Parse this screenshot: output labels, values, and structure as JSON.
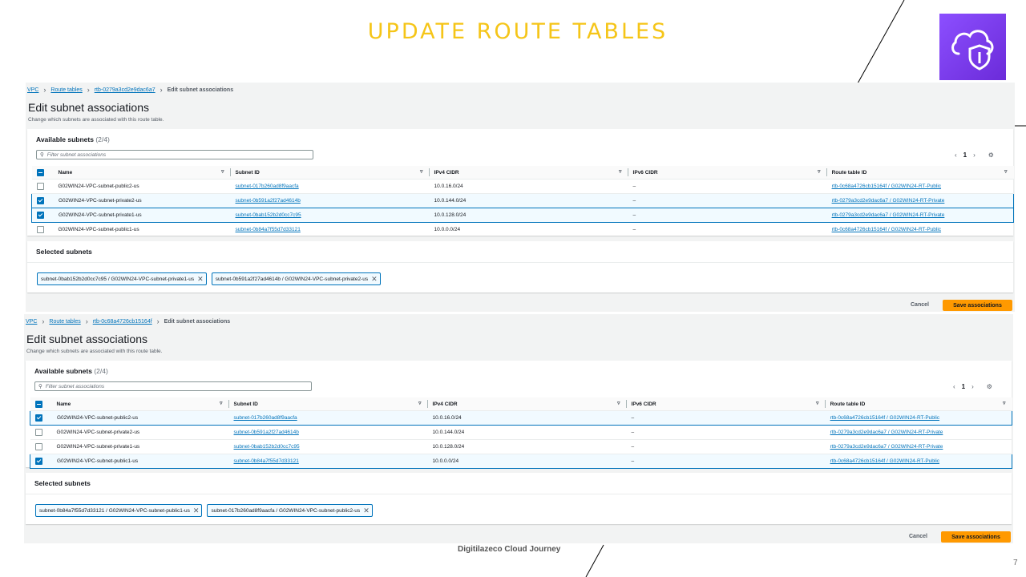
{
  "slide": {
    "title": "UPDATE ROUTE TABLES",
    "footer": "Digitilazeco Cloud Journey",
    "page_number": "7",
    "logo_icon": "cloud-shield-icon",
    "accent_color": "#f5c518",
    "aws_orange": "#ff9900",
    "link_color": "#0073bb"
  },
  "screens": [
    {
      "breadcrumbs": [
        "VPC",
        "Route tables",
        "rtb-0279a3cd2e9dac6a7",
        "Edit subnet associations"
      ],
      "title": "Edit subnet associations",
      "subtitle": "Change which subnets are associated with this route table.",
      "available_title": "Available subnets",
      "available_count": "(2/4)",
      "filter_placeholder": "Filter subnet associations",
      "page": "1",
      "columns": [
        "Name",
        "Subnet ID",
        "IPv4 CIDR",
        "IPv6 CIDR",
        "Route table ID"
      ],
      "rows": [
        {
          "checked": false,
          "name": "G02WIN24-VPC-subnet-public2-us",
          "subnet_id": "subnet-017b260ad8f9aacfa",
          "ipv4": "10.0.16.0/24",
          "ipv6": "–",
          "route_table": "rtb-0c68a4726cb15164f / G02WIN24-RT-Public"
        },
        {
          "checked": true,
          "name": "G02WIN24-VPC-subnet-private2-us",
          "subnet_id": "subnet-0b591a2f27ad4614b",
          "ipv4": "10.0.144.0/24",
          "ipv6": "–",
          "route_table": "rtb-0279a3cd2e9dac6a7 / G02WIN24-RT-Private"
        },
        {
          "checked": true,
          "name": "G02WIN24-VPC-subnet-private1-us",
          "subnet_id": "subnet-0bab152b2d0cc7c95",
          "ipv4": "10.0.128.0/24",
          "ipv6": "–",
          "route_table": "rtb-0279a3cd2e9dac6a7 / G02WIN24-RT-Private"
        },
        {
          "checked": false,
          "name": "G02WIN24-VPC-subnet-public1-us",
          "subnet_id": "subnet-0b84a7f55d7d33121",
          "ipv4": "10.0.0.0/24",
          "ipv6": "–",
          "route_table": "rtb-0c68a4726cb15164f / G02WIN24-RT-Public"
        }
      ],
      "selected_title": "Selected subnets",
      "selected": [
        "subnet-0bab152b2d0cc7c95 / G02WIN24-VPC-subnet-private1-us",
        "subnet-0b591a2f27ad4614b / G02WIN24-VPC-subnet-private2-us"
      ],
      "cancel": "Cancel",
      "save": "Save associations"
    },
    {
      "breadcrumbs": [
        "VPC",
        "Route tables",
        "rtb-0c68a4726cb15164f",
        "Edit subnet associations"
      ],
      "title": "Edit subnet associations",
      "subtitle": "Change which subnets are associated with this route table.",
      "available_title": "Available subnets",
      "available_count": "(2/4)",
      "filter_placeholder": "Filter subnet associations",
      "page": "1",
      "columns": [
        "Name",
        "Subnet ID",
        "IPv4 CIDR",
        "IPv6 CIDR",
        "Route table ID"
      ],
      "rows": [
        {
          "checked": true,
          "name": "G02WIN24-VPC-subnet-public2-us",
          "subnet_id": "subnet-017b260ad8f9aacfa",
          "ipv4": "10.0.16.0/24",
          "ipv6": "–",
          "route_table": "rtb-0c68a4726cb15164f / G02WIN24-RT-Public"
        },
        {
          "checked": false,
          "name": "G02WIN24-VPC-subnet-private2-us",
          "subnet_id": "subnet-0b591a2f27ad4614b",
          "ipv4": "10.0.144.0/24",
          "ipv6": "–",
          "route_table": "rtb-0279a3cd2e9dac6a7 / G02WIN24-RT-Private"
        },
        {
          "checked": false,
          "name": "G02WIN24-VPC-subnet-private1-us",
          "subnet_id": "subnet-0bab152b2d0cc7c95",
          "ipv4": "10.0.128.0/24",
          "ipv6": "–",
          "route_table": "rtb-0279a3cd2e9dac6a7 / G02WIN24-RT-Private"
        },
        {
          "checked": true,
          "name": "G02WIN24-VPC-subnet-public1-us",
          "subnet_id": "subnet-0b84a7f55d7d33121",
          "ipv4": "10.0.0.0/24",
          "ipv6": "–",
          "route_table": "rtb-0c68a4726cb15164f / G02WIN24-RT-Public"
        }
      ],
      "selected_title": "Selected subnets",
      "selected": [
        "subnet-0b84a7f55d7d33121 / G02WIN24-VPC-subnet-public1-us",
        "subnet-017b260ad8f9aacfa / G02WIN24-VPC-subnet-public2-us"
      ],
      "cancel": "Cancel",
      "save": "Save associations"
    }
  ]
}
